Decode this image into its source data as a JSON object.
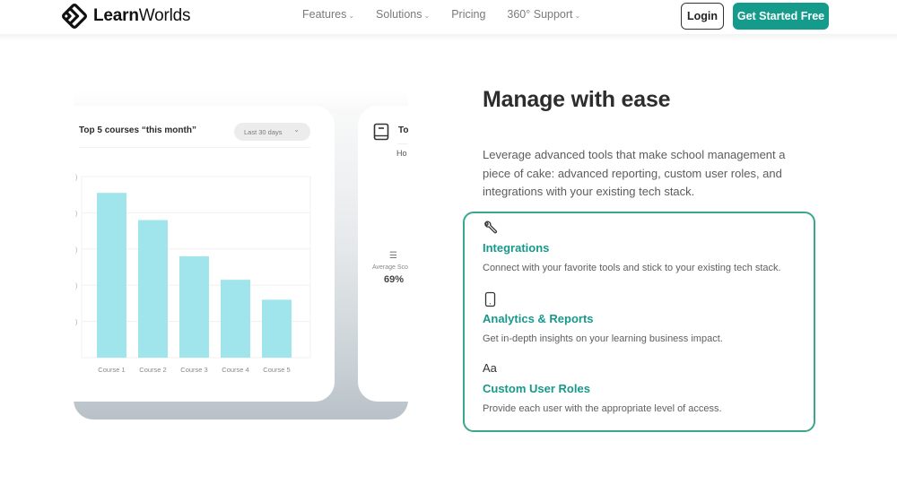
{
  "header": {
    "logo": {
      "bold": "Learn",
      "regular": "Worlds",
      "icon": "learnworlds-logo-icon"
    },
    "nav": [
      {
        "label": "Features",
        "has_dropdown": true
      },
      {
        "label": "Solutions",
        "has_dropdown": true
      },
      {
        "label": "Pricing",
        "has_dropdown": false
      },
      {
        "label": "360° Support",
        "has_dropdown": true
      }
    ],
    "chevron": "⌄",
    "login_label": "Login",
    "cta_label": "Get Started Free",
    "cta_color": "#149b8c"
  },
  "illustration": {
    "main_card": {
      "title": "Top 5 courses “this month”",
      "range_select": {
        "value": "Last 30 days",
        "icon": "chevron-down-icon"
      }
    },
    "side_card": {
      "icon": "book-icon",
      "title": "To",
      "subtitle": "Ho",
      "stat_icon": "checklist-icon",
      "stat_label": "Average Sco",
      "stat_value": "69%"
    }
  },
  "chart_data": {
    "type": "bar",
    "title": "Top 5 courses “this month”",
    "categories": [
      "Course 1",
      "Course 2",
      "Course 3",
      "Course 4",
      "Course 5"
    ],
    "values": [
      91,
      76,
      56,
      43,
      32
    ],
    "xlabel": "",
    "ylabel": "",
    "ylim": [
      0,
      100
    ],
    "yticks": [
      0,
      20,
      40,
      60,
      80,
      100
    ],
    "ytick_labels_visible": false,
    "grid": true,
    "bar_color": "#a0e5eb",
    "legend": "none"
  },
  "content": {
    "heading": "Manage with ease",
    "intro": "Leverage advanced tools that make school management a piece of cake: advanced reporting, custom user roles, and integrations with your existing tech stack.",
    "accent_color": "#17998a",
    "features": [
      {
        "icon": "wrench-icon",
        "title": "Integrations",
        "description": "Connect with your favorite tools and stick to your existing tech stack."
      },
      {
        "icon": "mobile-device-icon",
        "title": "Analytics & Reports",
        "description": "Get in-depth insights on your learning business impact."
      },
      {
        "icon": "typography-icon",
        "icon_glyph": "Aa",
        "title": "Custom User Roles",
        "description": "Provide each user with the appropriate level of access."
      }
    ]
  }
}
